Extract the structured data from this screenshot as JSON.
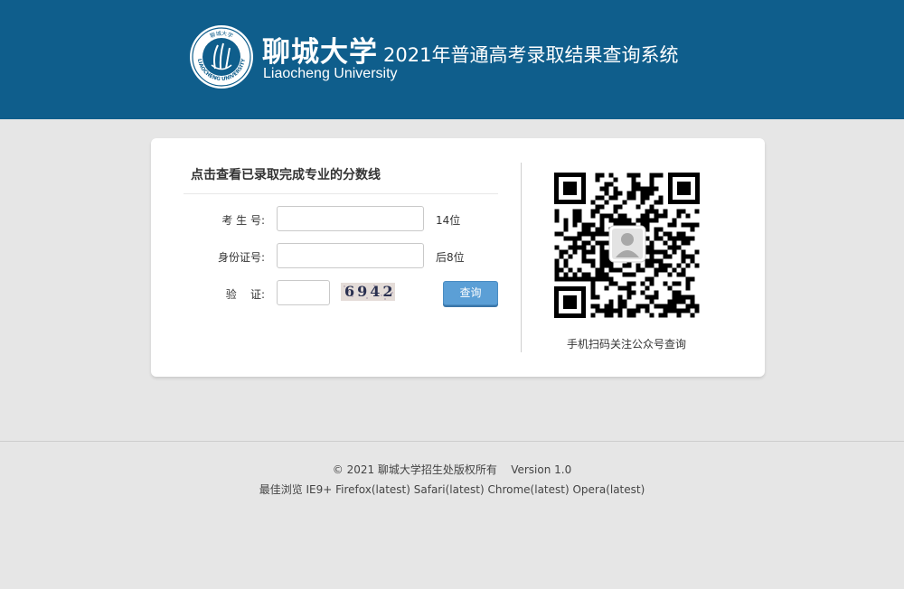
{
  "header": {
    "university_cn": "聊城大学",
    "university_en": "Liaocheng University",
    "system_title": "2021年普通高考录取结果查询系统",
    "logo_ring_text": "LIAOCHENG UNIVERSITY",
    "logo_top_text": "聊城大学"
  },
  "form": {
    "title": "点击查看已录取完成专业的分数线",
    "fields": [
      {
        "label": "考 生 号:",
        "value": "",
        "hint": "14位"
      },
      {
        "label": "身份证号:",
        "value": "",
        "hint": "后8位"
      },
      {
        "label": "验    证:",
        "value": ""
      }
    ],
    "captcha_text": "6942",
    "query_button": "查询"
  },
  "qr": {
    "caption": "手机扫码关注公众号查询"
  },
  "footer": {
    "line1": "© 2021 聊城大学招生处版权所有    Version 1.0",
    "line2": "最佳浏览 IE9+ Firefox(latest) Safari(latest) Chrome(latest) Opera(latest)"
  },
  "colors": {
    "header_bg": "#0f5e8c",
    "page_bg": "#e6e6e6",
    "button_bg": "#5b9fd6"
  }
}
